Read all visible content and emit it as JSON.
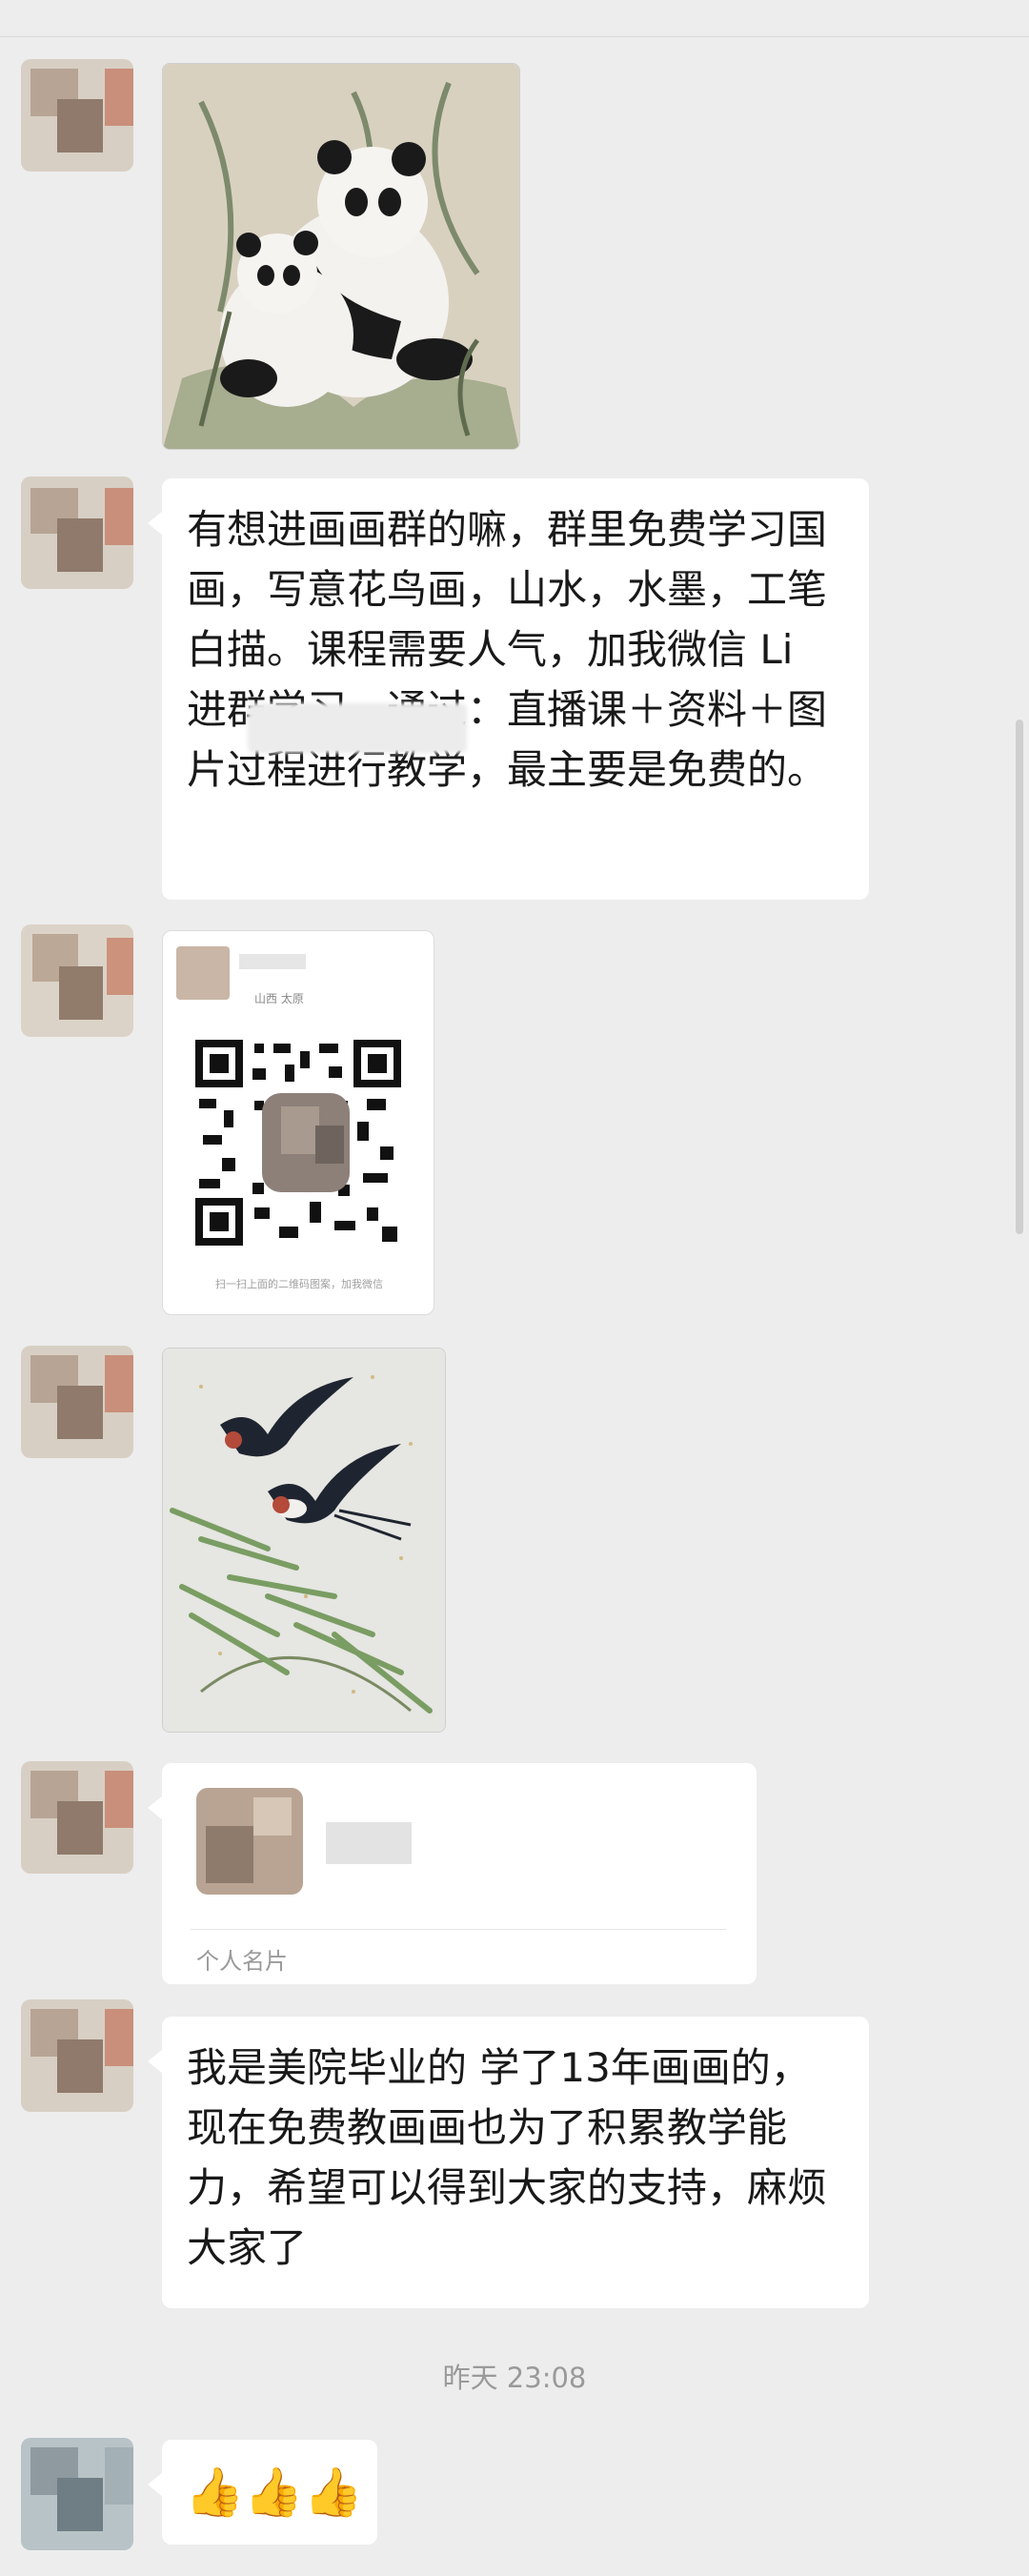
{
  "messages": [
    {
      "type": "image",
      "subject": "panda-painting"
    },
    {
      "type": "text",
      "text": "有想进画画群的嘛，群里免费学习国画，写意花鸟画，山水，水墨，工笔白描。课程需要人气，加我微信 Li          进群学习，通过：直播课＋资料＋图片过程进行教学，最主要是免费的。"
    },
    {
      "type": "qr-card",
      "location": "山西 太原",
      "caption": "扫一扫上面的二维码图案，加我微信"
    },
    {
      "type": "image",
      "subject": "swallows-bamboo-painting"
    },
    {
      "type": "contact-card",
      "footer": "个人名片"
    },
    {
      "type": "text",
      "text": "我是美院毕业的 学了13年画画的，现在免费教画画也为了积累教学能力，希望可以得到大家的支持，麻烦大家了"
    }
  ],
  "timestamp": "昨天 23:08",
  "last_message": {
    "type": "emoji",
    "text": "👍👍👍",
    "icon": "thumbs-up-icon"
  },
  "colors": {
    "background": "#ededed",
    "bubble": "#ffffff",
    "timestamp": "#9a9a9a"
  }
}
